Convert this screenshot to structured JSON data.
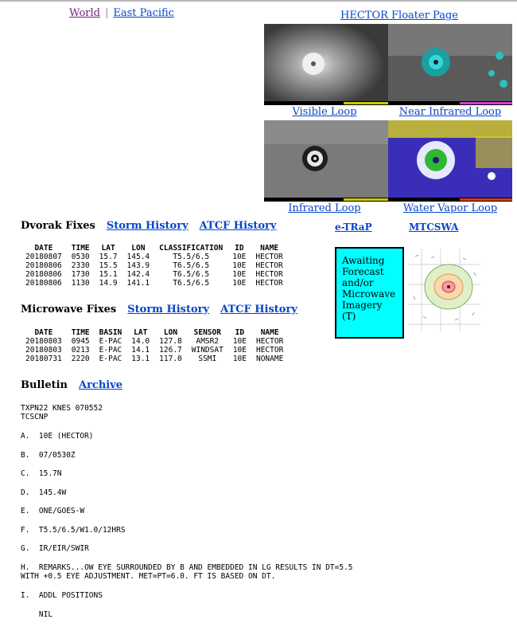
{
  "nav": {
    "world": "World",
    "separator": "|",
    "east_pacific": "East Pacific"
  },
  "floater_link": "HECTOR Floater Page",
  "thumbs": {
    "visible": "Visible Loop",
    "near_ir": "Near Infrared Loop",
    "infrared": "Infrared Loop",
    "water_vapor": "Water Vapor Loop"
  },
  "dvorak": {
    "title": "Dvorak Fixes",
    "storm_history": "Storm History",
    "atcf_history": "ATCF History",
    "headers": [
      "DATE",
      "TIME",
      "LAT",
      "LON",
      "CLASSIFICATION",
      "ID",
      "NAME"
    ],
    "rows": [
      [
        "20180807",
        "0530",
        "15.7",
        "145.4",
        "T5.5/6.5",
        "10E",
        "HECTOR"
      ],
      [
        "20180806",
        "2330",
        "15.5",
        "143.9",
        "T6.5/6.5",
        "10E",
        "HECTOR"
      ],
      [
        "20180806",
        "1730",
        "15.1",
        "142.4",
        "T6.5/6.5",
        "10E",
        "HECTOR"
      ],
      [
        "20180806",
        "1130",
        "14.9",
        "141.1",
        "T6.5/6.5",
        "10E",
        "HECTOR"
      ]
    ]
  },
  "side": {
    "etrap": "e-TRaP",
    "mtcswa": "MTCSWA",
    "awaiting": [
      "Awaiting",
      "Forecast",
      "and/or",
      "Microwave",
      "Imagery",
      "(T)"
    ]
  },
  "microwave": {
    "title": "Microwave Fixes",
    "storm_history": "Storm History",
    "atcf_history": "ATCF History",
    "headers": [
      "DATE",
      "TIME",
      "BASIN",
      "LAT",
      "LON",
      "SENSOR",
      "ID",
      "NAME"
    ],
    "rows": [
      [
        "20180803",
        "0945",
        "E-PAC",
        "14.0",
        "127.8",
        "AMSR2",
        "10E",
        "HECTOR"
      ],
      [
        "20180803",
        "0213",
        "E-PAC",
        "14.1",
        "126.7",
        "WINDSAT",
        "10E",
        "HECTOR"
      ],
      [
        "20180731",
        "2220",
        "E-PAC",
        "13.1",
        "117.0",
        "SSMI",
        "10E",
        "NONAME"
      ]
    ]
  },
  "bulletin": {
    "title": "Bulletin",
    "archive": "Archive",
    "header1": "TXPN22 KNES 070552",
    "header2": "TCSCNP",
    "a": "A.  10E (HECTOR)",
    "b": "B.  07/0530Z",
    "c": "C.  15.7N",
    "d": "D.  145.4W",
    "e": "E.  ONE/GOES-W",
    "f": "F.  T5.5/6.5/W1.0/12HRS",
    "g": "G.  IR/EIR/SWIR",
    "h1": "H.  REMARKS...OW EYE SURROUNDED BY B AND EMBEDDED IN LG RESULTS IN DT=5.5",
    "h2": "WITH +0.5 EYE ADJUSTMENT. MET=PT=6.0. FT IS BASED ON DT.",
    "i": "I.  ADDL POSITIONS",
    "nil": "    NIL"
  }
}
